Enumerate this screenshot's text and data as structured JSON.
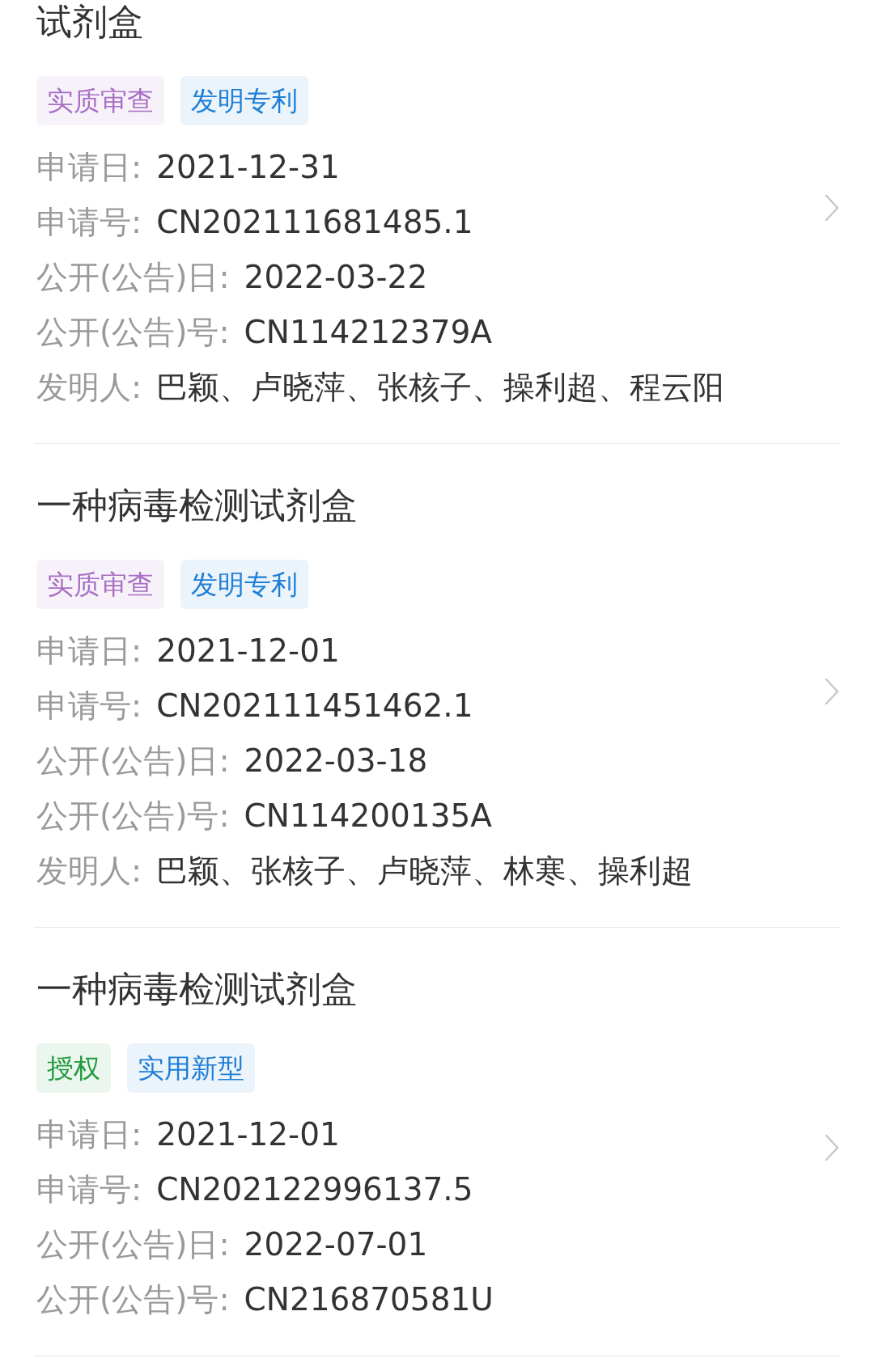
{
  "patents": [
    {
      "title": "试剂盒",
      "tags": [
        {
          "label": "实质审查",
          "color": "#a86fc4"
        },
        {
          "label": "发明专利",
          "color": "#1f7fd6"
        }
      ],
      "fields": [
        {
          "label": "申请日:",
          "value": "2021-12-31"
        },
        {
          "label": "申请号:",
          "value": "CN202111681485.1"
        },
        {
          "label": "公开(公告)日:",
          "value": "2022-03-22"
        },
        {
          "label": "公开(公告)号:",
          "value": "CN114212379A"
        },
        {
          "label": "发明人:",
          "value": "巴颖、卢晓萍、张核子、操利超、程云阳"
        }
      ]
    },
    {
      "title": "一种病毒检测试剂盒",
      "tags": [
        {
          "label": "实质审查",
          "color": "#a86fc4"
        },
        {
          "label": "发明专利",
          "color": "#1f7fd6"
        }
      ],
      "fields": [
        {
          "label": "申请日:",
          "value": "2021-12-01"
        },
        {
          "label": "申请号:",
          "value": "CN202111451462.1"
        },
        {
          "label": "公开(公告)日:",
          "value": "2022-03-18"
        },
        {
          "label": "公开(公告)号:",
          "value": "CN114200135A"
        },
        {
          "label": "发明人:",
          "value": "巴颖、张核子、卢晓萍、林寒、操利超"
        }
      ]
    },
    {
      "title": "一种病毒检测试剂盒",
      "tags": [
        {
          "label": "授权",
          "color": "#229a3e"
        },
        {
          "label": "实用新型",
          "color": "#1f7fd6"
        }
      ],
      "fields": [
        {
          "label": "申请日:",
          "value": "2021-12-01"
        },
        {
          "label": "申请号:",
          "value": "CN202122996137.5"
        },
        {
          "label": "公开(公告)日:",
          "value": "2022-07-01"
        },
        {
          "label": "公开(公告)号:",
          "value": "CN216870581U"
        }
      ]
    }
  ]
}
